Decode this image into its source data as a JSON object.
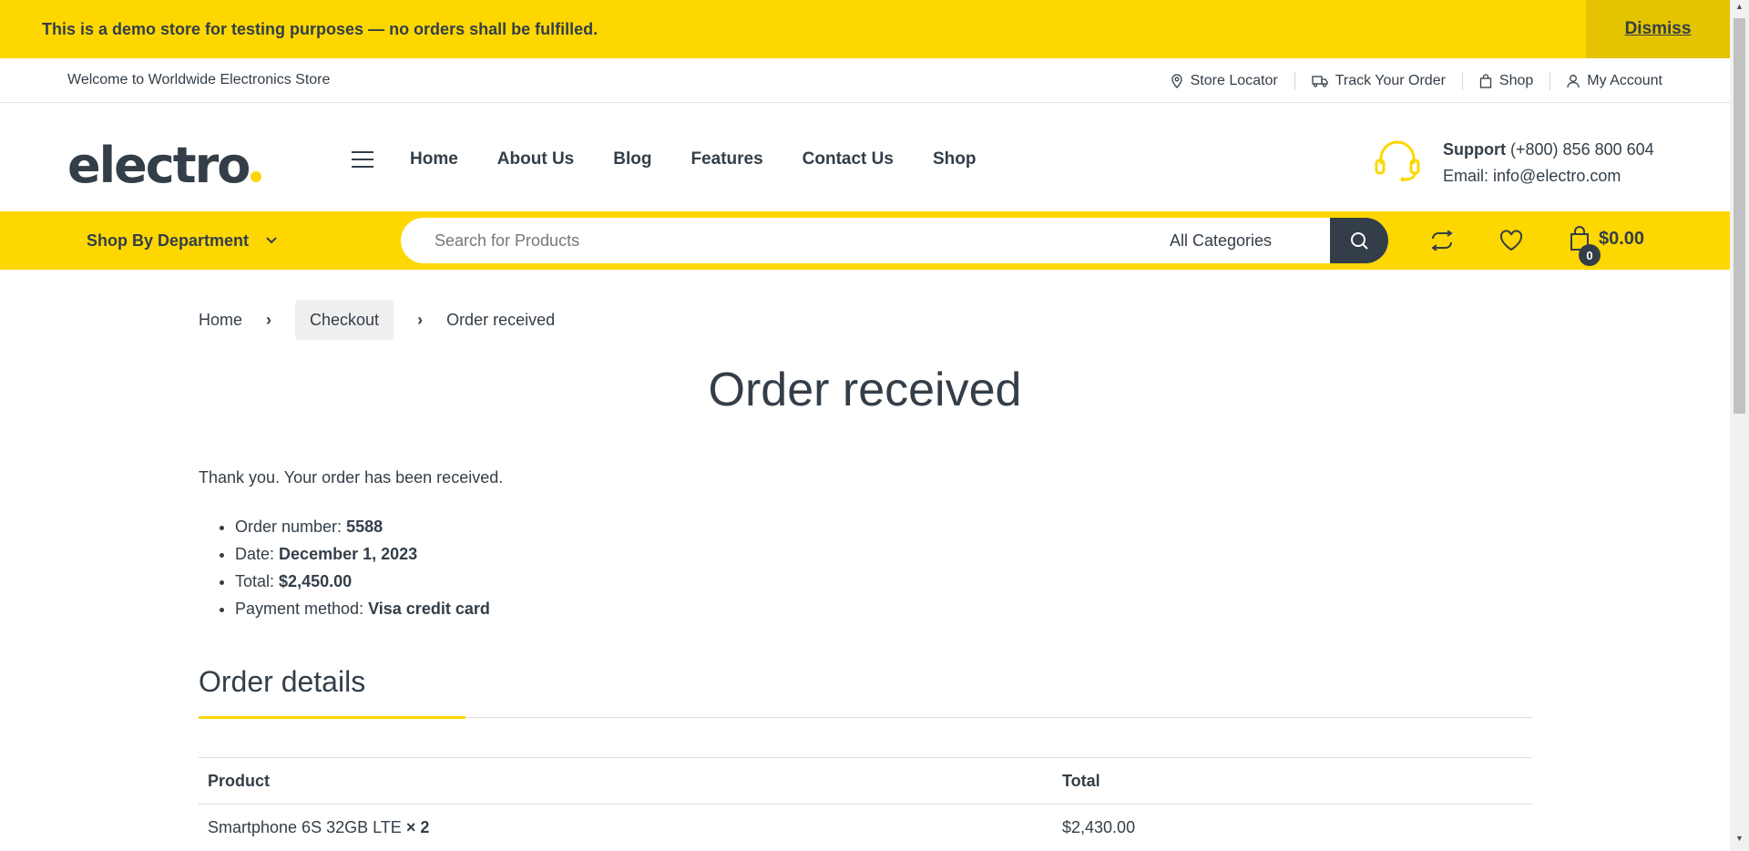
{
  "notice": {
    "message": "This is a demo store for testing purposes — no orders shall be fulfilled.",
    "dismiss": "Dismiss"
  },
  "topbar": {
    "welcome": "Welcome to Worldwide Electronics Store",
    "links": [
      "Store Locator",
      "Track Your Order",
      "Shop",
      "My Account"
    ]
  },
  "header": {
    "logo": "electro",
    "nav": [
      "Home",
      "About Us",
      "Blog",
      "Features",
      "Contact Us",
      "Shop"
    ],
    "support_label": "Support",
    "support_phone": "(+800) 856 800 604",
    "email": "Email: info@electro.com"
  },
  "searchbar": {
    "department": "Shop By Department",
    "placeholder": "Search for Products",
    "category": "All Categories",
    "cart_count": "0",
    "cart_total": "$0.00"
  },
  "breadcrumb": [
    "Home",
    "Checkout",
    "Order received"
  ],
  "page_title": "Order received",
  "thanks": "Thank you. Your order has been received.",
  "overview": {
    "order_label": "Order number:",
    "order_value": "5588",
    "date_label": "Date:",
    "date_value": "December 1, 2023",
    "total_label": "Total:",
    "total_value": "$2,450.00",
    "payment_label": "Payment method:",
    "payment_value": "Visa credit card"
  },
  "details": {
    "title": "Order details",
    "headers": [
      "Product",
      "Total"
    ],
    "rows": [
      {
        "product": "Smartphone 6S 32GB LTE",
        "qty": "× 2",
        "total": "$2,430.00"
      }
    ]
  },
  "colors": {
    "accent": "#fed700",
    "dark": "#333e48"
  }
}
